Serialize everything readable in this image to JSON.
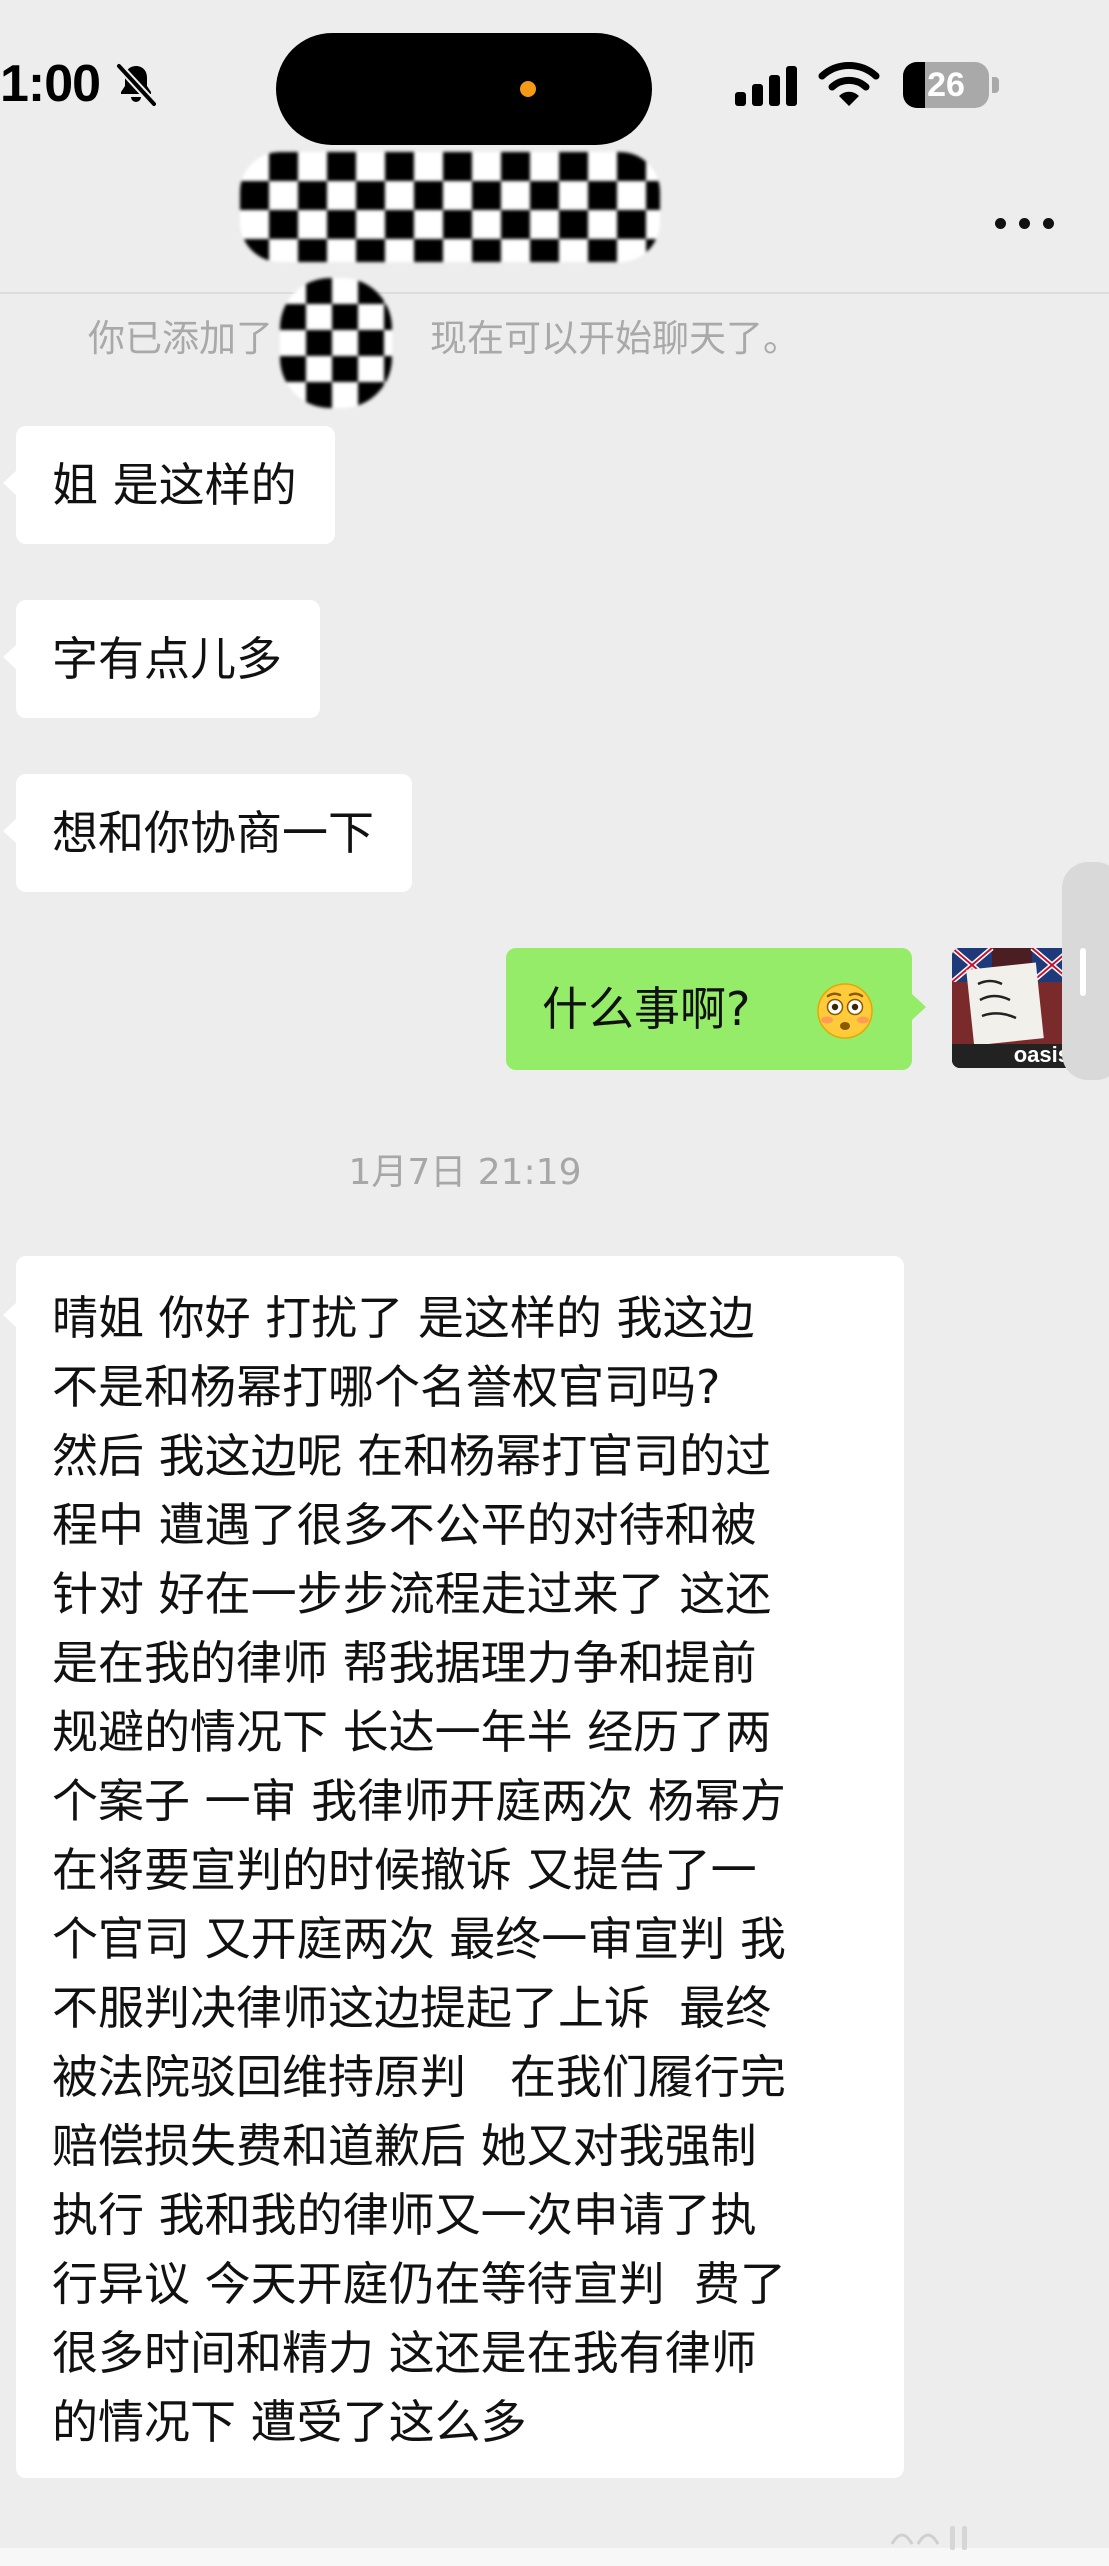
{
  "status_bar": {
    "time": "1:00",
    "battery_level": "26",
    "battery_fraction": 0.26
  },
  "chat": {
    "system_message_prefix": "你已添加了",
    "system_message_suffix": "现在可以开始聊天了。",
    "messages": [
      {
        "direction": "received",
        "text": "姐 是这样的"
      },
      {
        "direction": "received",
        "text": "字有点儿多"
      },
      {
        "direction": "received",
        "text": "想和你协商一下"
      },
      {
        "direction": "sent",
        "text": "什么事啊?",
        "emoji": "flushed-face-icon"
      }
    ],
    "timestamp": "1月7日 21:19",
    "long_message_lines": [
      "晴姐 你好 打扰了 是这样的 我这边",
      "不是和杨幂打哪个名誉权官司吗?",
      "然后 我这边呢 在和杨幂打官司的过",
      "程中 遭遇了很多不公平的对待和被",
      "针对 好在一步步流程走过来了 这还",
      "是在我的律师 帮我据理力争和提前",
      "规避的情况下 长达一年半 经历了两",
      "个案子 一审 我律师开庭两次 杨幂方",
      "在将要宣判的时候撤诉 又提告了一",
      "个官司 又开庭两次 最终一审宣判 我",
      "不服判决律师这边提起了上诉  最终",
      "被法院驳回维持原判   在我们履行完",
      "赔偿损失费和道歉后 她又对我强制",
      "执行 我和我的律师又一次申请了执",
      "行异议 今天开庭仍在等待宣判  费了",
      "很多时间和精力 这还是在我有律师",
      "的情况下 遭受了这么多"
    ],
    "avatar_label": "oasis"
  },
  "icons": {
    "status": [
      "bell-slash-icon",
      "signal-icon",
      "wifi-icon",
      "battery-icon"
    ],
    "nav": [
      "more-icon"
    ]
  },
  "colors": {
    "background": "#ededed",
    "sent_bubble": "#95ec69",
    "received_bubble": "#ffffff",
    "system_text": "#a9a9a9",
    "island_dot": "#f59a17"
  }
}
